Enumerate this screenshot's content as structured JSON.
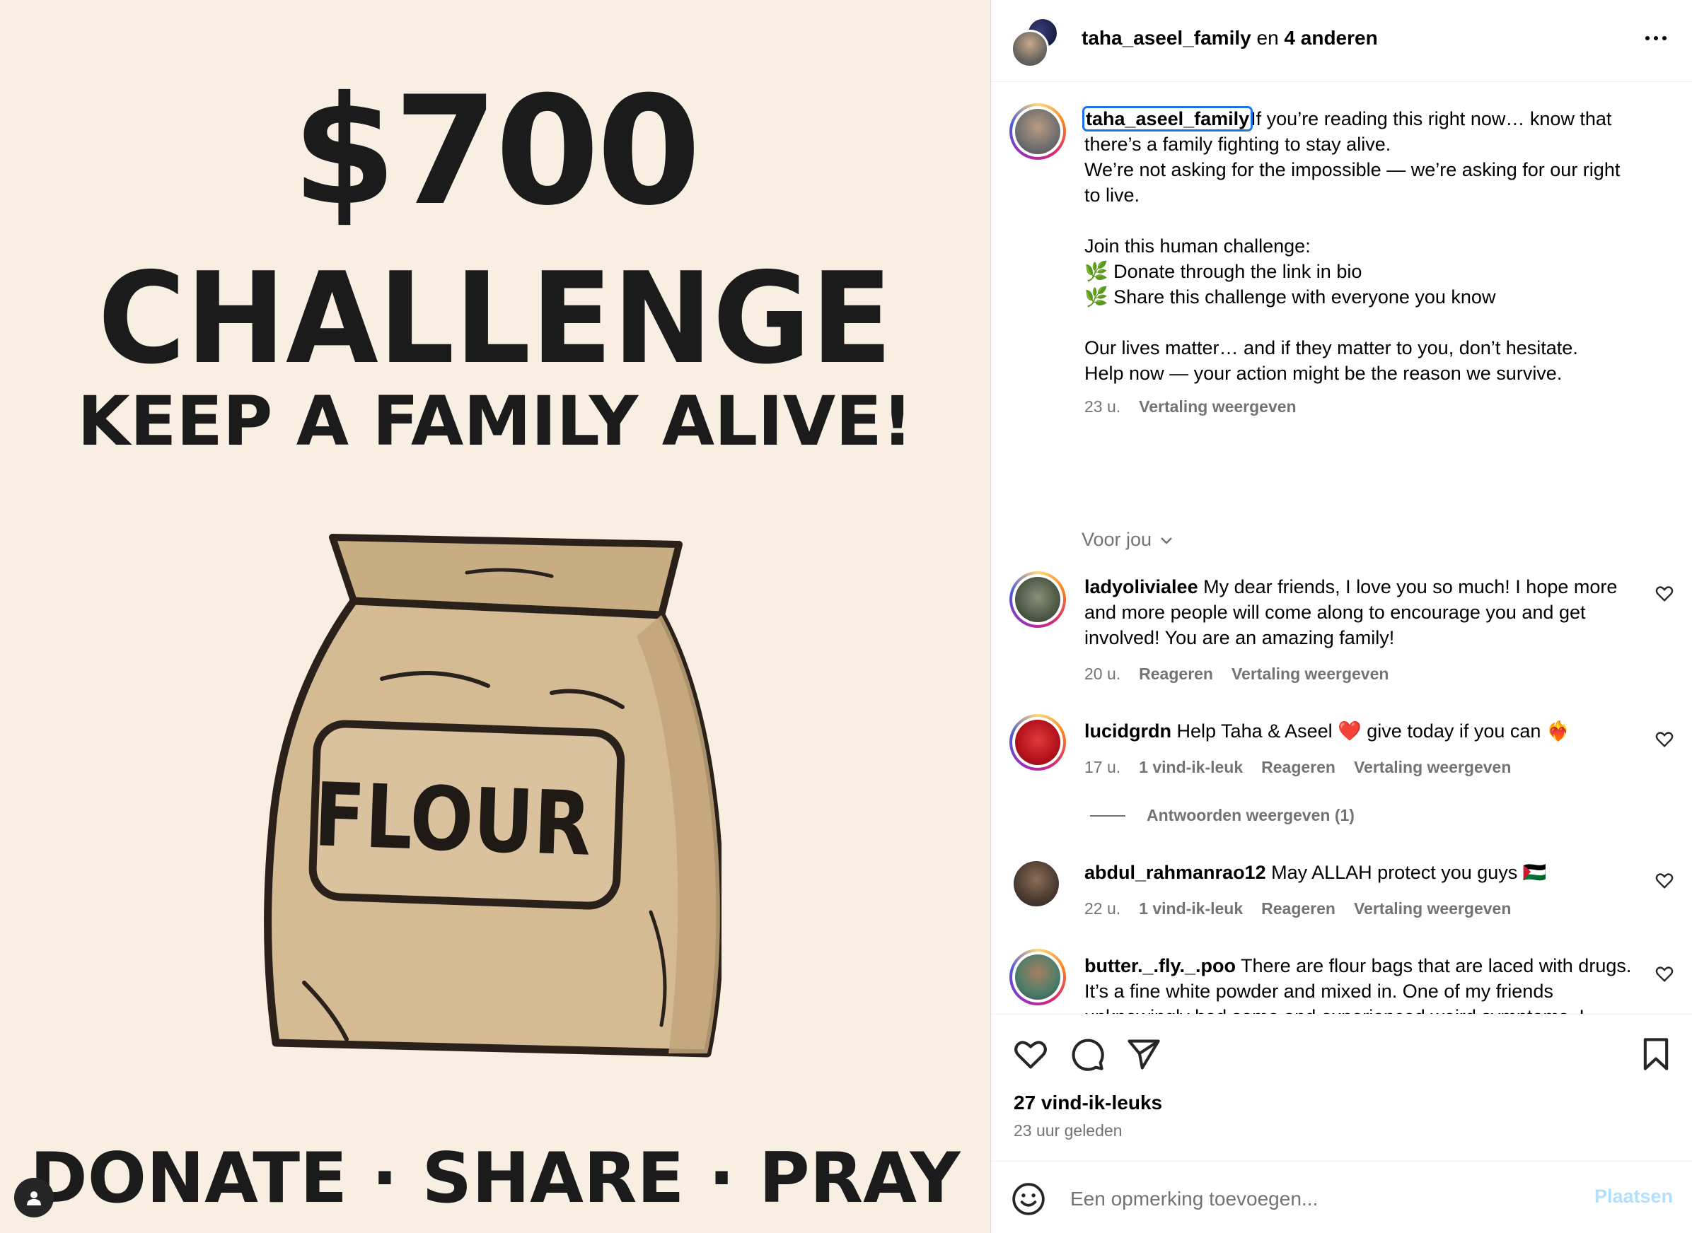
{
  "poster": {
    "amount": "$700",
    "challenge": "CHALLENGE",
    "subtitle": "KEEP A FAMILY ALIVE!",
    "bag_label": "FLOUR",
    "footer": "DONATE · SHARE · PRAY"
  },
  "header": {
    "username": "taha_aseel_family",
    "collab_text": " en ",
    "others": "4 anderen"
  },
  "caption": {
    "username": "taha_aseel_family",
    "first_line": "If you’re reading this right now… know that there’s a family fighting to stay alive.",
    "line2": "We’re not asking for the impossible — we’re asking for our right to live.",
    "line3": "Join this human challenge:",
    "line4": "🌿 Donate through the link in bio",
    "line5": "🌿 Share this challenge with everyone you know",
    "line6": "Our lives matter… and if they matter to you, don’t hesitate.",
    "line7": "Help now — your action might be the reason we survive.",
    "time": "23 u.",
    "translate": "Vertaling weergeven"
  },
  "for_you": "Voor jou",
  "comments": [
    {
      "username": "ladyolivialee",
      "text": "My dear friends, I love you so much! I hope more and more people will come along to encourage you and get involved! You are an amazing family!",
      "time": "20 u.",
      "reply": "Reageren",
      "translate": "Vertaling weergeven"
    },
    {
      "username": "lucidgrdn",
      "text": "Help Taha & Aseel ❤️ give today if you can ❤️‍🔥",
      "time": "17 u.",
      "likes": "1 vind-ik-leuk",
      "reply": "Reageren",
      "translate": "Vertaling weergeven"
    },
    {
      "username": "abdul_rahmanrao12",
      "text": "May ALLAH protect you guys 🇵🇸",
      "time": "22 u.",
      "likes": "1 vind-ik-leuk",
      "reply": "Reageren",
      "translate": "Vertaling weergeven"
    },
    {
      "username": "butter._.fly._.poo",
      "text": "There are flour bags that are laced with drugs. It’s a fine white powder and mixed in. One of my friends unknowingly had some and experienced weird symptoms. I might have already told you this, I don’t remember but I figure I would post it here so everyone can the comments can share the message too."
    }
  ],
  "view_replies": "Antwoorden weergeven (1)",
  "post_stats": {
    "likes": "27 vind-ik-leuks",
    "time_ago": "23 uur geleden"
  },
  "composer": {
    "placeholder": "Een opmerking toevoegen...",
    "post_label": "Plaatsen"
  },
  "icons": {
    "like": "heart-icon",
    "comment": "comment-icon",
    "share": "send-icon",
    "save": "bookmark-icon",
    "emoji": "emoji-icon",
    "more": "more-icon",
    "tagged": "user-tag-icon"
  },
  "colors": {
    "poster_bg": "#f8eee1",
    "bag": "#d4bb94",
    "muted": "#737373",
    "link_disabled": "#b2dffc",
    "focus": "#1a73e8"
  }
}
